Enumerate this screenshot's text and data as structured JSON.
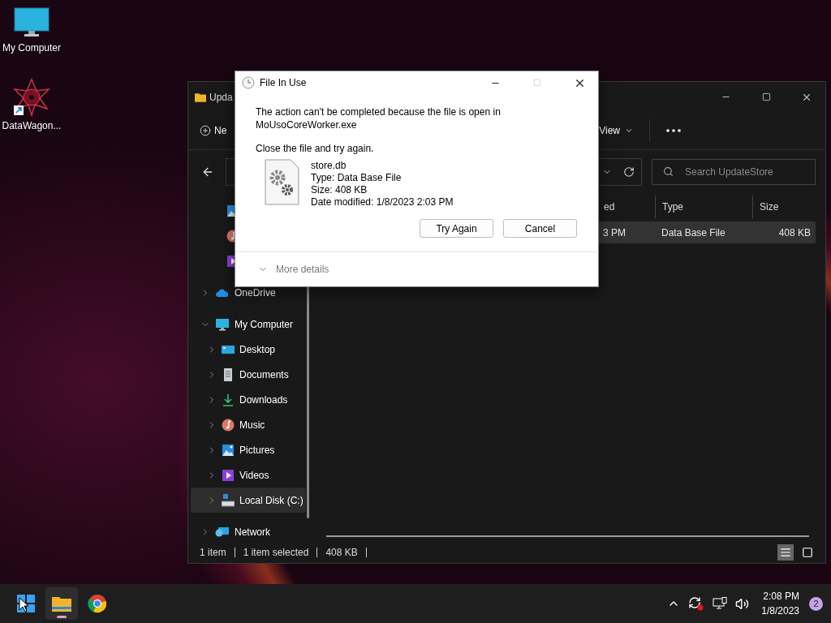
{
  "desktop_icons": [
    {
      "kind": "computer",
      "label": "My Computer",
      "shortcut": false
    },
    {
      "kind": "app",
      "label": "DataWagon...",
      "shortcut": true
    }
  ],
  "explorer": {
    "title": "Upda",
    "new_label": "Ne",
    "view_label": "View",
    "search": {
      "placeholder": "Search UpdateStore"
    },
    "columns": [
      "ed",
      "Type",
      "Size"
    ],
    "rows": [
      {
        "cells": [
          "3 PM",
          "Data Base File",
          "408 KB"
        ],
        "selected": true
      }
    ],
    "sidebar": {
      "pinned": [
        {
          "kind": "pictures"
        },
        {
          "kind": "music"
        },
        {
          "kind": "videos"
        }
      ],
      "items": [
        {
          "kind": "onedrive",
          "label": "OneDrive",
          "expanded": false,
          "selected": false
        },
        {
          "kind": "computer",
          "label": "My Computer",
          "expanded": true,
          "selected": false,
          "children": [
            {
              "kind": "desktop",
              "label": "Desktop",
              "expanded": false,
              "selected": false
            },
            {
              "kind": "documents",
              "label": "Documents",
              "expanded": false,
              "selected": false
            },
            {
              "kind": "downloads",
              "label": "Downloads",
              "expanded": false,
              "selected": false
            },
            {
              "kind": "music",
              "label": "Music",
              "expanded": false,
              "selected": false
            },
            {
              "kind": "pictures",
              "label": "Pictures",
              "expanded": false,
              "selected": false
            },
            {
              "kind": "videos",
              "label": "Videos",
              "expanded": false,
              "selected": false
            },
            {
              "kind": "disk",
              "label": "Local Disk (C:)",
              "expanded": false,
              "selected": true
            }
          ]
        },
        {
          "kind": "network",
          "label": "Network",
          "expanded": false,
          "selected": false
        }
      ]
    },
    "status": [
      "1 item",
      "1 item selected",
      "408 KB"
    ],
    "view_modes": [
      {
        "kind": "details",
        "selected": true
      },
      {
        "kind": "tiles",
        "selected": false
      }
    ]
  },
  "dialog": {
    "title": "File In Use",
    "message": "The action can't be completed because the file is open in MoUsoCoreWorker.exe",
    "instruction": "Close the file and try again.",
    "file": {
      "name": "store.db",
      "details": [
        "Type: Data Base File",
        "Size: 408 KB",
        "Date modified: 1/8/2023 2:03 PM"
      ]
    },
    "buttons": [
      "Try Again",
      "Cancel"
    ],
    "more_details": "More details"
  },
  "taskbar": {
    "apps": [
      {
        "kind": "start",
        "running": false
      },
      {
        "kind": "explorer",
        "running": true
      },
      {
        "kind": "chrome",
        "running": false
      }
    ],
    "time": "2:08 PM",
    "date": "1/8/2023",
    "notifications": "2"
  }
}
